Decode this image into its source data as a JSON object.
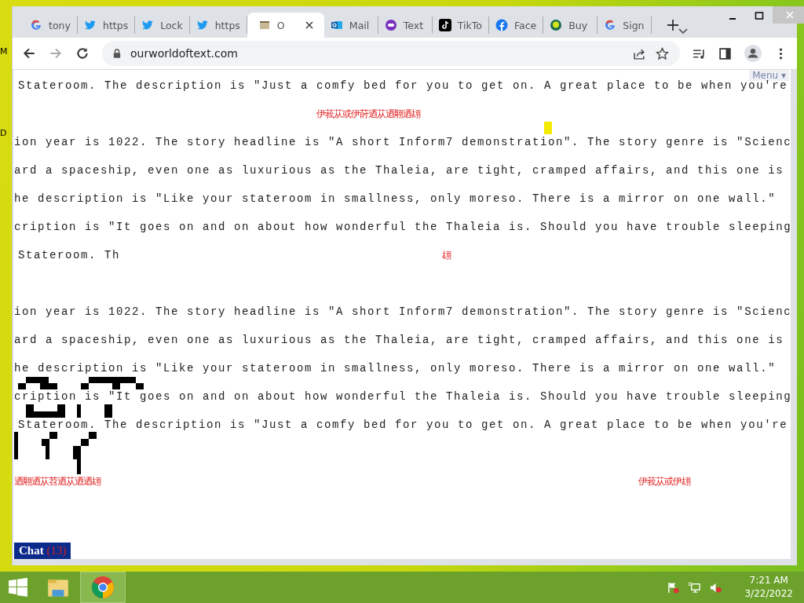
{
  "desktop": {
    "labels": [
      "M",
      "D"
    ]
  },
  "browser": {
    "tabs": [
      {
        "label": "tony",
        "selected": false
      },
      {
        "label": "https",
        "selected": false
      },
      {
        "label": "Lock",
        "selected": false
      },
      {
        "label": "https",
        "selected": false
      },
      {
        "label": "O",
        "selected": true
      },
      {
        "label": "Mail",
        "selected": false
      },
      {
        "label": "Text",
        "selected": false
      },
      {
        "label": "TikTo",
        "selected": false
      },
      {
        "label": "Face",
        "selected": false
      },
      {
        "label": "Buy",
        "selected": false
      },
      {
        "label": "Sign",
        "selected": false
      }
    ],
    "address": "ourworldoftext.com"
  },
  "page": {
    "menu": "Menu ▾",
    "rows": [
      {
        "segments": [
          {
            "kind": "plain",
            "text": "Stateroom. The description is \"Just a comfy bed for you to get on. A great place to be when you're"
          }
        ]
      },
      {
        "segments": [
          {
            "kind": "red",
            "text": "伊莪苁或伊莳迺苁迺翢迺翃"
          }
        ]
      },
      {
        "segments": [
          {
            "kind": "plain",
            "text": "ion year is 1022. The story headline is \"A short Inform7 demonstration\". The story genre is \"Scienc"
          }
        ]
      },
      {
        "segments": [
          {
            "kind": "plain",
            "text": "ard a spaceship, even one as luxurious as the Thaleia, are tight, cramped affairs, and this one is"
          }
        ]
      },
      {
        "segments": [
          {
            "kind": "plain",
            "text": "he description is \"Like your stateroom in smallness, only moreso. There is a mirror on one wall.\""
          }
        ]
      },
      {
        "segments": [
          {
            "kind": "plain",
            "text": "cription is \"It goes on and on about how wonderful the Thaleia is. Should you have trouble sleeping"
          }
        ]
      },
      {
        "segments": [
          {
            "kind": "plain",
            "text": "Stateroom. Th"
          },
          {
            "kind": "red",
            "text": "翃"
          }
        ]
      },
      {
        "segments": []
      },
      {
        "segments": [
          {
            "kind": "plain",
            "text": "ion year is 1022. The story headline is \"A short Inform7 demonstration\". The story genre is \"Scienc"
          }
        ]
      },
      {
        "segments": [
          {
            "kind": "plain",
            "text": "ard a spaceship, even one as luxurious as the Thaleia, are tight, cramped affairs, and this one is"
          }
        ]
      },
      {
        "segments": [
          {
            "kind": "plain",
            "text": "he description is \"Like your stateroom in smallness, only moreso. There is a mirror on one wall.\""
          }
        ]
      },
      {
        "segments": [
          {
            "kind": "plain",
            "text": "cription is \"It goes on and on about how wonderful the Thaleia is. Should you have trouble sleeping"
          }
        ]
      },
      {
        "segments": [
          {
            "kind": "plain",
            "text": "Stateroom. The description is \"Just a comfy bed for you to get on. A great place to be when you're"
          }
        ]
      },
      {
        "segments": []
      },
      {
        "segments": [
          {
            "kind": "red",
            "text": "迺翢迺苁苕迺苁迺迺翃"
          },
          {
            "kind": "red",
            "text": "伊莪苁或伊翃"
          }
        ]
      }
    ],
    "chat": {
      "label": "Chat",
      "count": "(13)"
    }
  },
  "taskbar": {
    "time": "7:21 AM",
    "date": "3/22/2022"
  }
}
